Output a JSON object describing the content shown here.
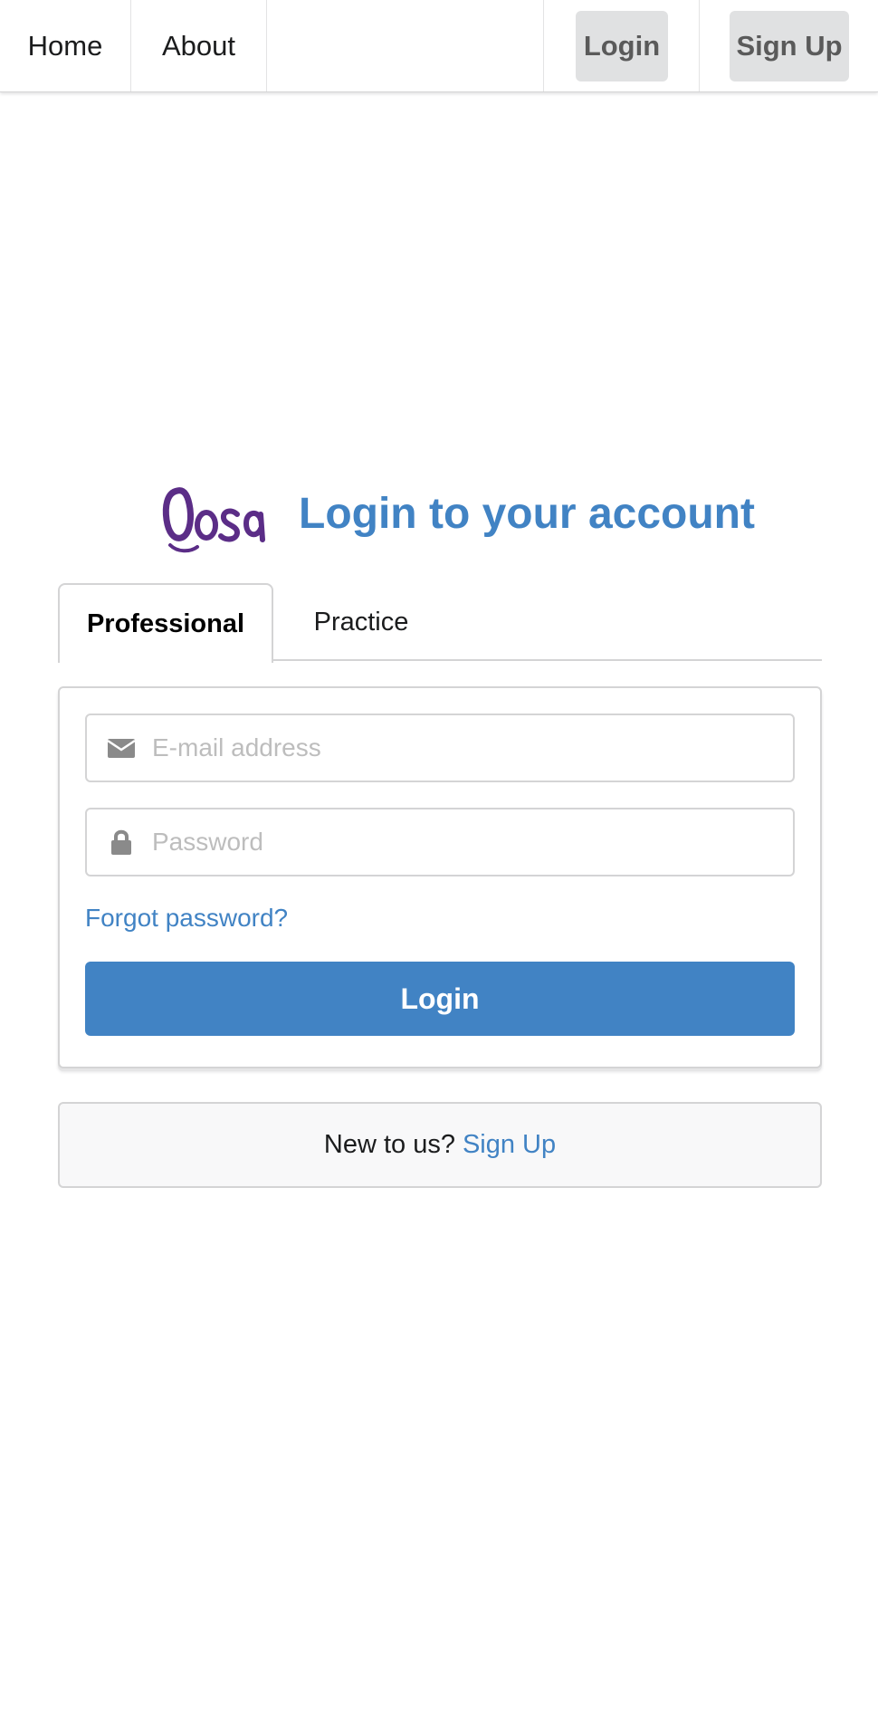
{
  "nav": {
    "home_label": "Home",
    "about_label": "About",
    "login_label": "Login",
    "signup_label": "Sign Up"
  },
  "header": {
    "logo_text": "Qosa",
    "title": "Login to your account"
  },
  "tabs": [
    {
      "label": "Professional",
      "active": true
    },
    {
      "label": "Practice",
      "active": false
    }
  ],
  "form": {
    "email": {
      "placeholder": "E-mail address",
      "value": "",
      "icon": "envelope-icon"
    },
    "password": {
      "placeholder": "Password",
      "value": "",
      "icon": "lock-icon"
    },
    "forgot_label": "Forgot password?",
    "submit_label": "Login"
  },
  "signup": {
    "prompt": "New to us?",
    "link_label": "Sign Up"
  },
  "colors": {
    "accent": "#4183c4",
    "logo": "#5b2d87",
    "button_gray": "#e0e1e2",
    "border": "#d4d4d5"
  }
}
